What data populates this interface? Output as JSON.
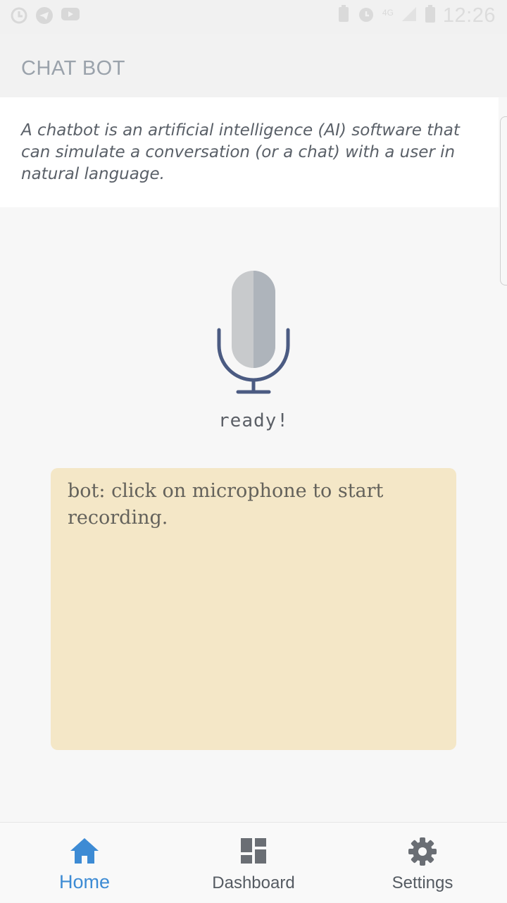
{
  "status_bar": {
    "time": "12:26",
    "network": "4G"
  },
  "app_bar": {
    "title": "CHAT BOT"
  },
  "description": {
    "text": "A chatbot is an artificial intelligence (AI) software that can simulate a conversation (or a chat) with a user in natural language."
  },
  "mic": {
    "status": "ready!"
  },
  "chat": {
    "message": "bot: click on microphone to start recording."
  },
  "bottom_nav": {
    "items": [
      {
        "label": "Home",
        "icon": "home-icon",
        "active": true
      },
      {
        "label": "Dashboard",
        "icon": "dashboard-icon",
        "active": false
      },
      {
        "label": "Settings",
        "icon": "gear-icon",
        "active": false
      }
    ]
  },
  "colors": {
    "accent": "#3d8bd4",
    "chat_bg": "#f4e7c7",
    "mic_stand": "#4b5b82"
  }
}
